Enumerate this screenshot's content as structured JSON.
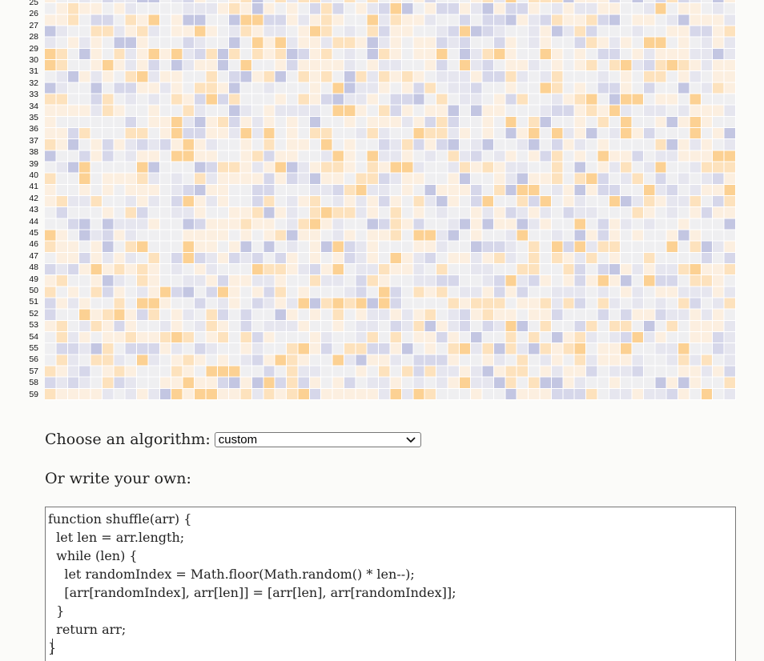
{
  "matrix": {
    "row_labels": [
      "25",
      "26",
      "27",
      "28",
      "29",
      "30",
      "31",
      "32",
      "33",
      "34",
      "35",
      "36",
      "37",
      "38",
      "39",
      "40",
      "41",
      "42",
      "43",
      "44",
      "45",
      "46",
      "47",
      "48",
      "49",
      "50",
      "51",
      "52",
      "53",
      "54",
      "55",
      "56",
      "57",
      "58",
      "59"
    ],
    "colors": {
      "neutral": "#efeff1",
      "warm_light": "#fcefe0",
      "warm_mid": "#fde2bd",
      "warm_strong": "#fcd193",
      "cool_light": "#e6e6ef",
      "cool_mid": "#d6d7ea",
      "cool_strong": "#c3c6e2"
    }
  },
  "controls": {
    "algorithm_label": "Choose an algorithm:",
    "algorithm_selected": "custom",
    "write_own_label": "Or write your own:"
  },
  "editor": {
    "code": "function shuffle(arr) {\n  let len = arr.length;\n  while (len) {\n    let randomIndex = Math.floor(Math.random() * len--);\n    [arr[randomIndex], arr[len]] = [arr[len], arr[randomIndex]];\n  }\n  return arr;\n}"
  }
}
